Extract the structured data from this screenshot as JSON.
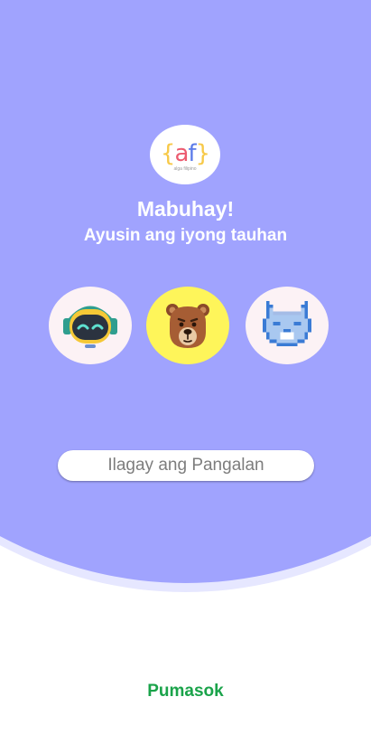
{
  "logo": {
    "mark_open": "{",
    "mark_a": "a",
    "mark_f": "f",
    "mark_close": "}",
    "subtitle": "alga filipino"
  },
  "greeting": "Mabuhay!",
  "subtitle": "Ayusin ang iyong tauhan",
  "avatars": [
    {
      "icon": "robot-icon",
      "selected": false
    },
    {
      "icon": "bear-icon",
      "selected": true
    },
    {
      "icon": "pixel-cat-icon",
      "selected": false
    }
  ],
  "name_input": {
    "placeholder": "Ilagay ang Pangalan",
    "value": ""
  },
  "enter_button": "Pumasok",
  "colors": {
    "background_purple": "#a0a3fe",
    "halo": "#e6e7ff",
    "selected_avatar": "#fef55a",
    "avatar_bg": "#fcf2f5",
    "enter_green": "#1aa34a"
  }
}
